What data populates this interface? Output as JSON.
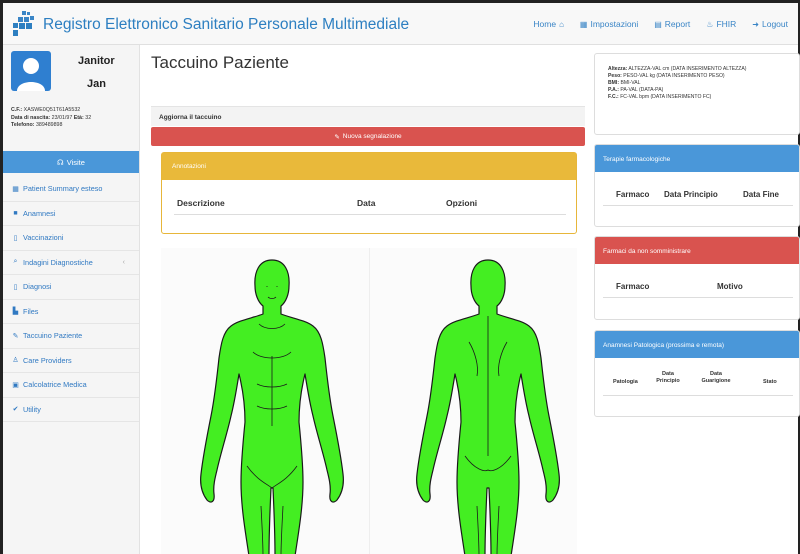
{
  "navbar": {
    "brand": "Registro Elettronico Sanitario Personale Multimediale",
    "links": [
      {
        "label": "Home",
        "icon": "home-icon"
      },
      {
        "label": "Impostazioni",
        "icon": "settings-icon"
      },
      {
        "label": "Report",
        "icon": "report-icon"
      },
      {
        "label": "FHIR",
        "icon": "fhir-icon"
      },
      {
        "label": "Logout",
        "icon": "logout-icon"
      }
    ]
  },
  "user": {
    "first": "Janitor",
    "last": "Jan",
    "cf_label": "C.F.:",
    "cf": "XASWE0Q51T61A5532",
    "dob_label": "Data di nascita:",
    "dob": "23/01/97",
    "age_label": "Età:",
    "age": "32",
    "phone_label": "Telefono:",
    "phone": "389489898"
  },
  "sidebar": {
    "visite": "Visite",
    "items": [
      {
        "label": "Patient Summary esteso",
        "icon": "grid-icon"
      },
      {
        "label": "Anamnesi",
        "icon": "book-icon"
      },
      {
        "label": "Vaccinazioni",
        "icon": "file-icon"
      },
      {
        "label": "Indagini Diagnostiche",
        "icon": "search-icon"
      },
      {
        "label": "Diagnosi",
        "icon": "clipboard-icon"
      },
      {
        "label": "Files",
        "icon": "files-icon"
      },
      {
        "label": "Taccuino Paziente",
        "icon": "notebook-icon"
      },
      {
        "label": "Care Providers",
        "icon": "users-icon"
      },
      {
        "label": "Calcolatrice Medica",
        "icon": "calculator-icon"
      },
      {
        "label": "Utility",
        "icon": "utility-icon"
      }
    ]
  },
  "main": {
    "title": "Taccuino Paziente",
    "update_label": "Aggiorna il taccuino",
    "new_button": "Nuova segnalazione",
    "annotations": {
      "title": "Annotazioni",
      "columns": [
        "Descrizione",
        "Data",
        "Opzioni"
      ]
    }
  },
  "vitals": {
    "height_label": "Altezza:",
    "height": "ALTEZZA-VAL cm (DATA INSERIMENTO ALTEZZA)",
    "weight_label": "Peso:",
    "weight": "PESO-VAL kg (DATA INSERIMENTO PESO)",
    "bmi_label": "BMI:",
    "bmi": "BMI-VAL",
    "pa_label": "P.A.:",
    "pa": "PA-VAL (DATA-PA)",
    "fc_label": "F.C.:",
    "fc": "FC-VAL bpm (DATA INSERIMENTO FC)"
  },
  "panels": {
    "terapie": {
      "title": "Terapie farmacologiche",
      "columns": [
        "Farmaco",
        "Data Principio",
        "Data Fine"
      ]
    },
    "non_somm": {
      "title": "Farmaci da non somministrare",
      "columns": [
        "Farmaco",
        "Motivo"
      ]
    },
    "anamnesi": {
      "title": "Anamnesi Patologica (prossima e remota)",
      "columns": [
        "Patologia",
        "Data Principio",
        "Data Guarigione",
        "Stato"
      ]
    }
  },
  "colors": {
    "brand": "#2d7fc1",
    "primary": "#4a97d9",
    "danger": "#d9534f",
    "warning": "#e9b93a",
    "body": "#44ee22"
  }
}
